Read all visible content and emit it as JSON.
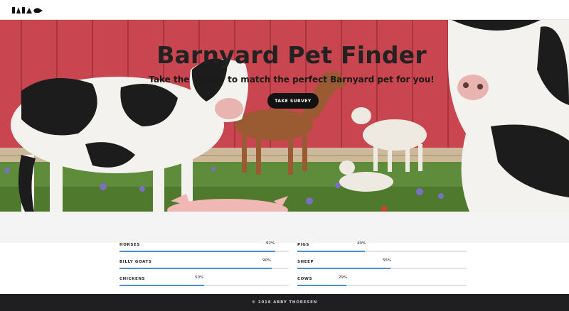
{
  "hero": {
    "title": "Barnyard Pet Finder",
    "subtitle": "Take the survey to match the perfect Barnyard pet for you!",
    "button_label": "TAKE SURVEY"
  },
  "stats": {
    "left": [
      {
        "label": "HORSES",
        "percent": 92,
        "percent_label": "92%"
      },
      {
        "label": "BILLY GOATS",
        "percent": 90,
        "percent_label": "90%"
      },
      {
        "label": "CHICKENS",
        "percent": 50,
        "percent_label": "50%"
      }
    ],
    "right": [
      {
        "label": "PIGS",
        "percent": 40,
        "percent_label": "40%"
      },
      {
        "label": "SHEEP",
        "percent": 55,
        "percent_label": "55%"
      },
      {
        "label": "COWS",
        "percent": 29,
        "percent_label": "29%"
      }
    ]
  },
  "footer": {
    "text": "© 2018 ABBY THORESEN"
  },
  "colors": {
    "bar": "#4a90d9",
    "footer_bg": "#1f1f22",
    "barn_red": "#c94a53"
  }
}
